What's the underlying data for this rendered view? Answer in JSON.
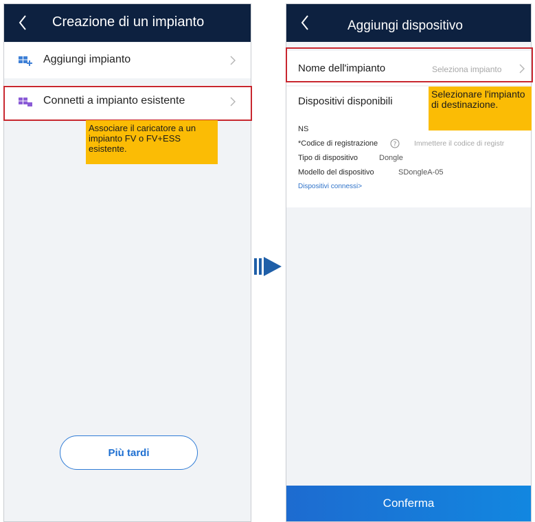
{
  "left_screen": {
    "title": "Creazione di un impianto",
    "items": [
      {
        "label": "Aggiungi impianto",
        "icon": "add-plant-icon"
      },
      {
        "label": "Connetti a impianto esistente",
        "icon": "connect-plant-icon"
      }
    ],
    "callout": "Associare il caricatore a un impianto FV o FV+ESS esistente.",
    "later_button": "Più tardi"
  },
  "right_screen": {
    "title": "Aggiungi dispositivo",
    "plant_name_label": "Nome dell'impianto",
    "plant_name_placeholder": "Seleziona impianto",
    "available_devices_label": "Dispositivi disponibili",
    "callout": "Selezionare l'impianto di destinazione.",
    "fields": {
      "sn_label": "NS",
      "reg_code_label": "*Codice di registrazione",
      "reg_code_placeholder": "Immettere il codice di registr",
      "device_type_label": "Tipo di dispositivo",
      "device_type_value": "Dongle",
      "device_model_label": "Modello del dispositivo",
      "device_model_value": "SDongleA-05"
    },
    "connected_link": "Dispositivi connessi>",
    "confirm_button": "Conferma"
  },
  "colors": {
    "header": "#0d2140",
    "highlight_box": "#c8262e",
    "callout": "#fbbc05",
    "accent": "#1e6fd1"
  }
}
